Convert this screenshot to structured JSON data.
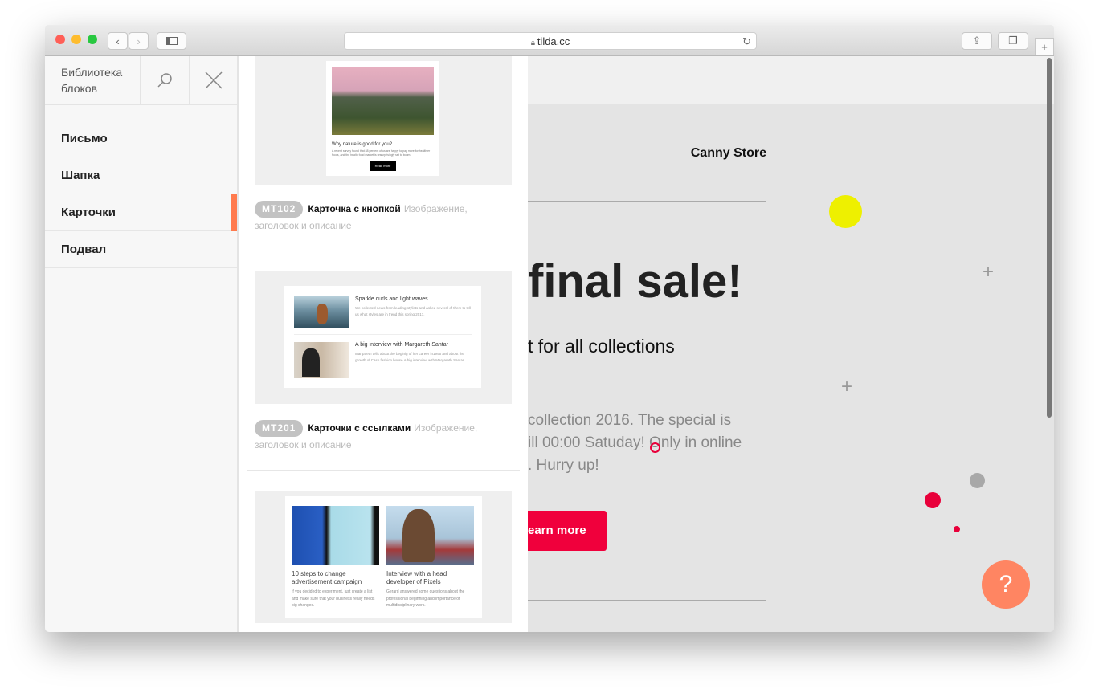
{
  "browser": {
    "url": "tilda.cc",
    "colors": {
      "close": "#ff5f57",
      "minimize": "#febc2e",
      "zoom": "#28c840"
    }
  },
  "sidebar": {
    "title": "Библиотека блоков",
    "items": [
      {
        "label": "Письмо"
      },
      {
        "label": "Шапка"
      },
      {
        "label": "Карточки",
        "active": true
      },
      {
        "label": "Подвал"
      }
    ],
    "accent": "#ff7a4d"
  },
  "blocks": [
    {
      "code": "MT102",
      "name": "Карточка с кнопкой",
      "desc": "Изображение, заголовок и описание",
      "preview": {
        "title": "Why nature is good for you?",
        "text": "A recent survey found that 88 percent of us are happy to pay more for healthier foods, and the health food market is unsurprisingly set to boom.",
        "button": "Read more"
      }
    },
    {
      "code": "MT201",
      "name": "Карточки с ссылками",
      "desc": "Изображение, заголовок и описание",
      "preview": {
        "items": [
          {
            "title": "Sparkle curls and light waves",
            "text": "We collected news from leading stylists and asked several of them to tell us what styles are in trend this spring 2017."
          },
          {
            "title": "A big interview with Margareth Santar",
            "text": "Margareth tells about the beginig of her career in1995 and about the growth of Caso fashion house.A big interview with Margareth Santar"
          }
        ]
      }
    },
    {
      "preview": {
        "items": [
          {
            "title": "10 steps to change advertisement campaign",
            "text": "If you decided to experiment, just create a list and make sure that your business really needs big changes."
          },
          {
            "title": "Interview with a head developer of Pixels",
            "text": "Gerard answered some questions about the professional beginning and importance of multidisciplinary work."
          }
        ]
      }
    }
  ],
  "page": {
    "brand": "Canny Store",
    "headline": "final sale!",
    "subheadline": "t for all collections",
    "body": [
      "collection 2016. The special is",
      "ill 00:00 Satuday! Only in online",
      ". Hurry up!"
    ],
    "button": "earn more",
    "button_color": "#f0003c",
    "help": "?",
    "help_color": "#ff8562"
  }
}
